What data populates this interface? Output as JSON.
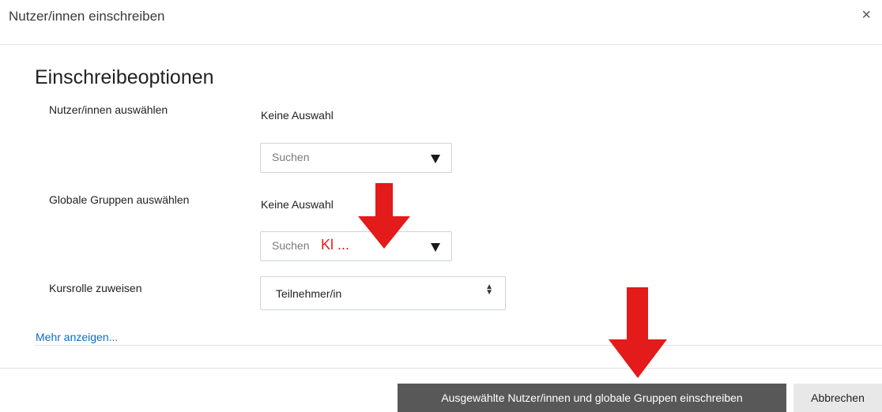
{
  "modal": {
    "title": "Nutzer/innen einschreiben",
    "close_symbol": "×"
  },
  "section": {
    "title": "Einschreibeoptionen"
  },
  "users": {
    "label": "Nutzer/innen auswählen",
    "selection": "Keine Auswahl",
    "search_placeholder": "Suchen"
  },
  "groups": {
    "label": "Globale Gruppen auswählen",
    "selection": "Keine Auswahl",
    "search_placeholder": "Suchen",
    "search_value": "Kl ..."
  },
  "role": {
    "label": "Kursrolle zuweisen",
    "value": "Teilnehmer/in"
  },
  "more_link": "Mehr anzeigen...",
  "footer": {
    "primary_label": "Ausgewählte Nutzer/innen und globale Gruppen einschreiben",
    "cancel_label": "Abbrechen"
  },
  "annotation_color": "#e31b1b",
  "icons": [
    "close-icon",
    "dropdown-triangle-icon",
    "updown-chevron-icon",
    "red-arrow-annotation"
  ]
}
